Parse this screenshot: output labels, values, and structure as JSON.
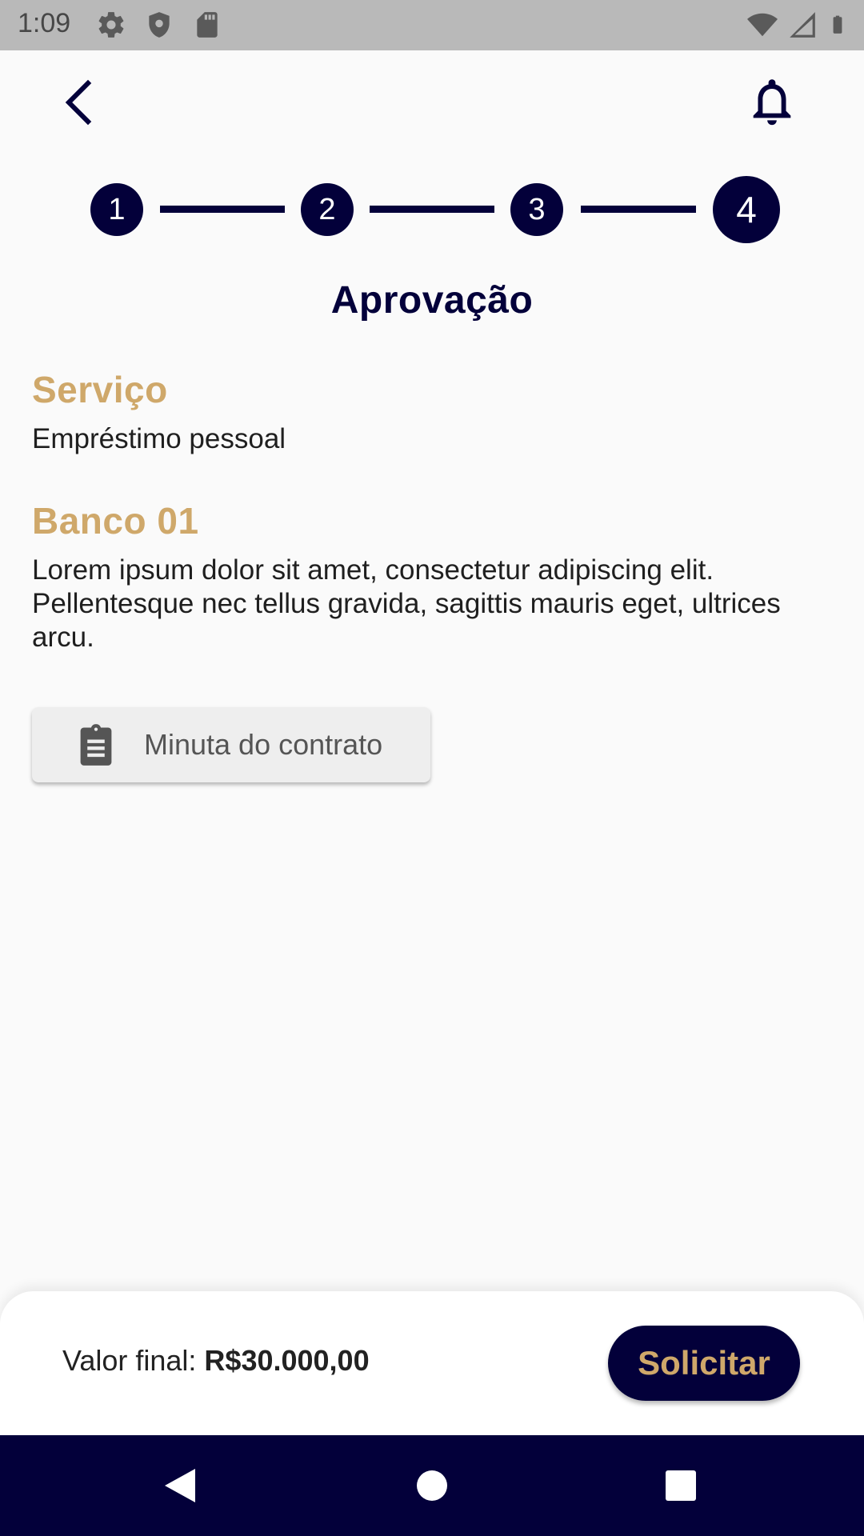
{
  "status_bar": {
    "time": "1:09",
    "left_icons": [
      "settings-icon",
      "shield-icon",
      "sd-card-icon"
    ],
    "right_icons": [
      "wifi-icon",
      "signal-icon",
      "battery-icon"
    ]
  },
  "app_bar": {
    "back_icon": "chevron-left-icon",
    "notification_icon": "bell-icon"
  },
  "stepper": {
    "steps": [
      "1",
      "2",
      "3",
      "4"
    ],
    "current_step": 4
  },
  "page": {
    "title": "Aprovação"
  },
  "service": {
    "heading": "Serviço",
    "value": "Empréstimo pessoal"
  },
  "bank": {
    "heading": "Banco 01",
    "description": "Lorem ipsum dolor sit amet, consectetur adipiscing elit. Pellentesque nec tellus gravida, sagittis mauris eget, ultrices arcu."
  },
  "contract_button": {
    "icon": "clipboard-icon",
    "label": "Minuta do contrato"
  },
  "bottom_sheet": {
    "final_value_label": "Valor final: ",
    "final_value_amount": "R$30.000,00",
    "request_button_label": "Solicitar"
  },
  "nav_bar": {
    "buttons": [
      "back-triangle-icon",
      "home-circle-icon",
      "recents-square-icon"
    ]
  },
  "colors": {
    "primary": "#03003a",
    "accent": "#cfa86a",
    "background": "#fafafa",
    "status_bar": "#b9b9b9"
  }
}
